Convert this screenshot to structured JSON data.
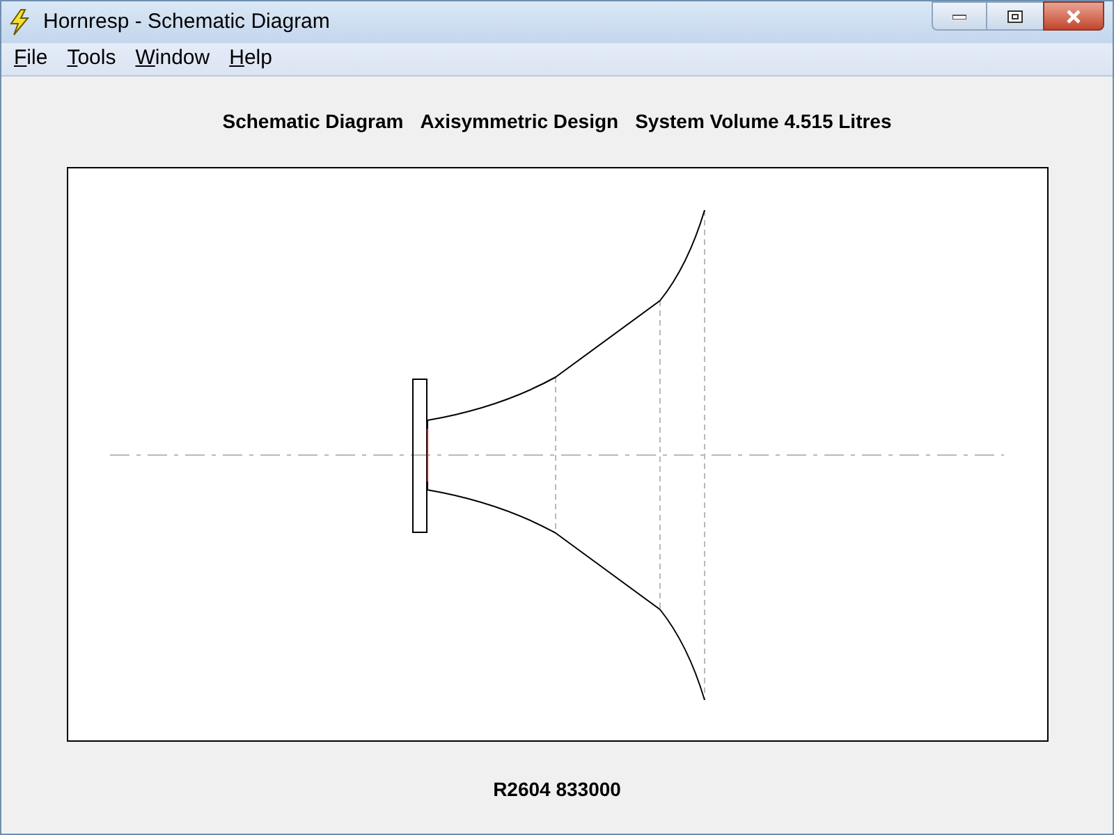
{
  "window": {
    "title": "Hornresp - Schematic Diagram"
  },
  "menu": [
    {
      "label": "File"
    },
    {
      "label": "Tools"
    },
    {
      "label": "Window"
    },
    {
      "label": "Help"
    }
  ],
  "heading": [
    "Schematic Diagram",
    "Axisymmetric Design",
    "System Volume 4.515 Litres"
  ],
  "status": "R2604 833000"
}
